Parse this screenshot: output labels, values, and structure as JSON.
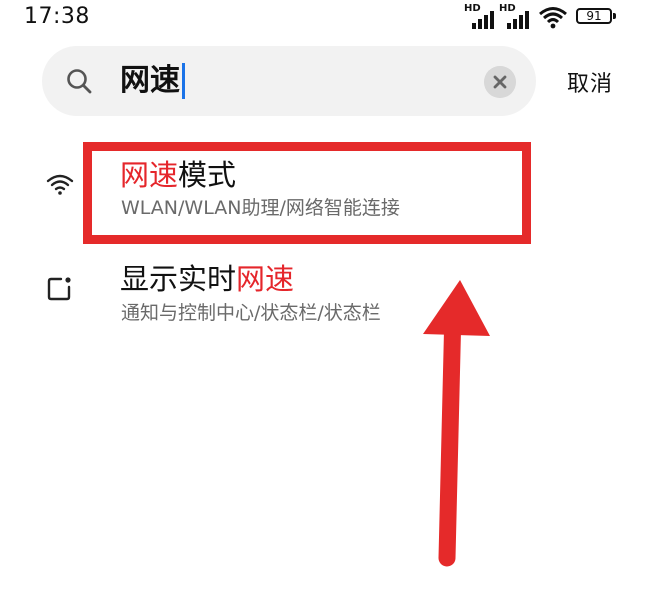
{
  "status_bar": {
    "time": "17:38",
    "signal_1_label": "HD",
    "signal_2_label": "HD",
    "battery": "91"
  },
  "search": {
    "query": "网速",
    "cancel_label": "取消"
  },
  "results": [
    {
      "icon": "wifi-icon",
      "title_highlight": "网速",
      "title_rest": "模式",
      "path": "WLAN/WLAN助理/网络智能连接"
    },
    {
      "icon": "status-bar-icon",
      "title_prefix": "显示实时",
      "title_highlight": "网速",
      "path": "通知与控制中心/状态栏/状态栏"
    }
  ],
  "colors": {
    "highlight": "#e5262b",
    "annotation": "#e52a2a",
    "caret": "#1a73e8"
  }
}
